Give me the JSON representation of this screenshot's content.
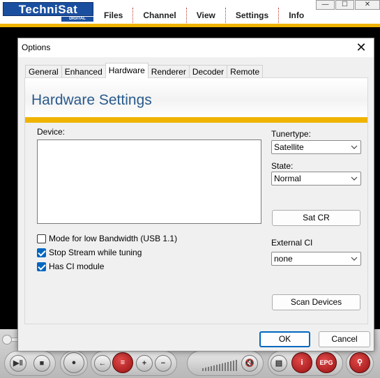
{
  "app": {
    "logo_text": "TechniSat",
    "logo_sub": "DIGITAL",
    "menu": [
      "Files",
      "Channel",
      "View",
      "Settings",
      "Info"
    ],
    "window_controls": {
      "minimize": "—",
      "maximize": "☐",
      "close": "✕"
    }
  },
  "player": {
    "buttons": {
      "play_pause": "▶‖",
      "stop": "■",
      "record": "●",
      "back": "←",
      "epg_list": "≡",
      "zoom_in": "+",
      "zoom_out": "−",
      "mute": "🔇",
      "teletext": "▤",
      "info": "i",
      "epg": "EPG",
      "search": "⚲"
    }
  },
  "dialog": {
    "title": "Options",
    "close_glyph": "✕",
    "tabs": [
      "General",
      "Enhanced",
      "Hardware",
      "Renderer",
      "Decoder",
      "Remote"
    ],
    "active_tab": "Hardware",
    "panel_title": "Hardware Settings",
    "device_label": "Device:",
    "checkboxes": [
      {
        "label": "Mode for low Bandwidth (USB 1.1)",
        "checked": false
      },
      {
        "label": "Stop Stream while tuning",
        "checked": true
      },
      {
        "label": "Has CI module",
        "checked": true
      }
    ],
    "tunertype_label": "Tunertype:",
    "tunertype_value": "Satellite",
    "state_label": "State:",
    "state_value": "Normal",
    "satcr_button": "Sat CR",
    "external_ci_label": "External CI",
    "external_ci_value": "none",
    "scan_button": "Scan Devices",
    "ok_button": "OK",
    "cancel_button": "Cancel"
  },
  "colors": {
    "accent_gold": "#f0b400",
    "brand_blue": "#1a4fa0",
    "title_blue": "#2a5a8c",
    "focus_blue": "#0067c0"
  }
}
